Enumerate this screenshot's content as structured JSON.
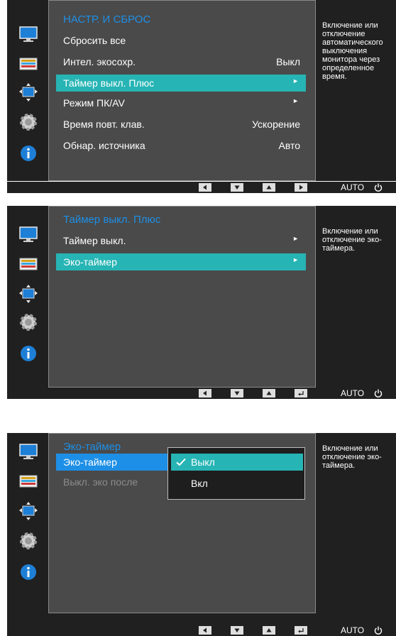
{
  "panels": [
    {
      "menu_title": "НАСТР. И СБРОС",
      "items": [
        {
          "label": "Сбросить все",
          "value": "",
          "arrow": ""
        },
        {
          "label": "Интел. экосохр.",
          "value": "Выкл",
          "arrow": ""
        },
        {
          "label": "Таймер выкл. Плюс",
          "value": "",
          "arrow": "►"
        },
        {
          "label": "Режим ПК/AV",
          "value": "",
          "arrow": "►"
        },
        {
          "label": "Время повт. клав.",
          "value": "Ускорение",
          "arrow": ""
        },
        {
          "label": "Обнар. источника",
          "value": "Авто",
          "arrow": ""
        }
      ],
      "help": "Включение или отключение автоматического выключения монитора через определенное время.",
      "bar": {
        "auto": "AUTO"
      }
    },
    {
      "menu_title": "Таймер выкл. Плюс",
      "items": [
        {
          "label": "Таймер выкл.",
          "arrow": "►"
        },
        {
          "label": "Эко-таймер",
          "arrow": "►"
        }
      ],
      "help": "Включение или отключение эко-таймера.",
      "bar": {
        "auto": "AUTO"
      }
    },
    {
      "menu_title": "Эко-таймер",
      "items": [
        {
          "label": "Эко-таймер"
        },
        {
          "label": "Выкл. эко после"
        }
      ],
      "popup_options": [
        {
          "label": "Выкл",
          "checked": true
        },
        {
          "label": "Вкл",
          "checked": false
        }
      ],
      "help": "Включение или отключение эко-таймера.",
      "bar": {
        "auto": "AUTO"
      }
    }
  ],
  "icons": [
    "monitor-icon",
    "color-icon",
    "size-position-icon",
    "gear-icon",
    "info-icon"
  ],
  "colors": {
    "accent_title": "#1d8fe6",
    "selection": "#27b4b4",
    "menu_bg": "#4a4a4a",
    "osd_bg": "#202020"
  }
}
